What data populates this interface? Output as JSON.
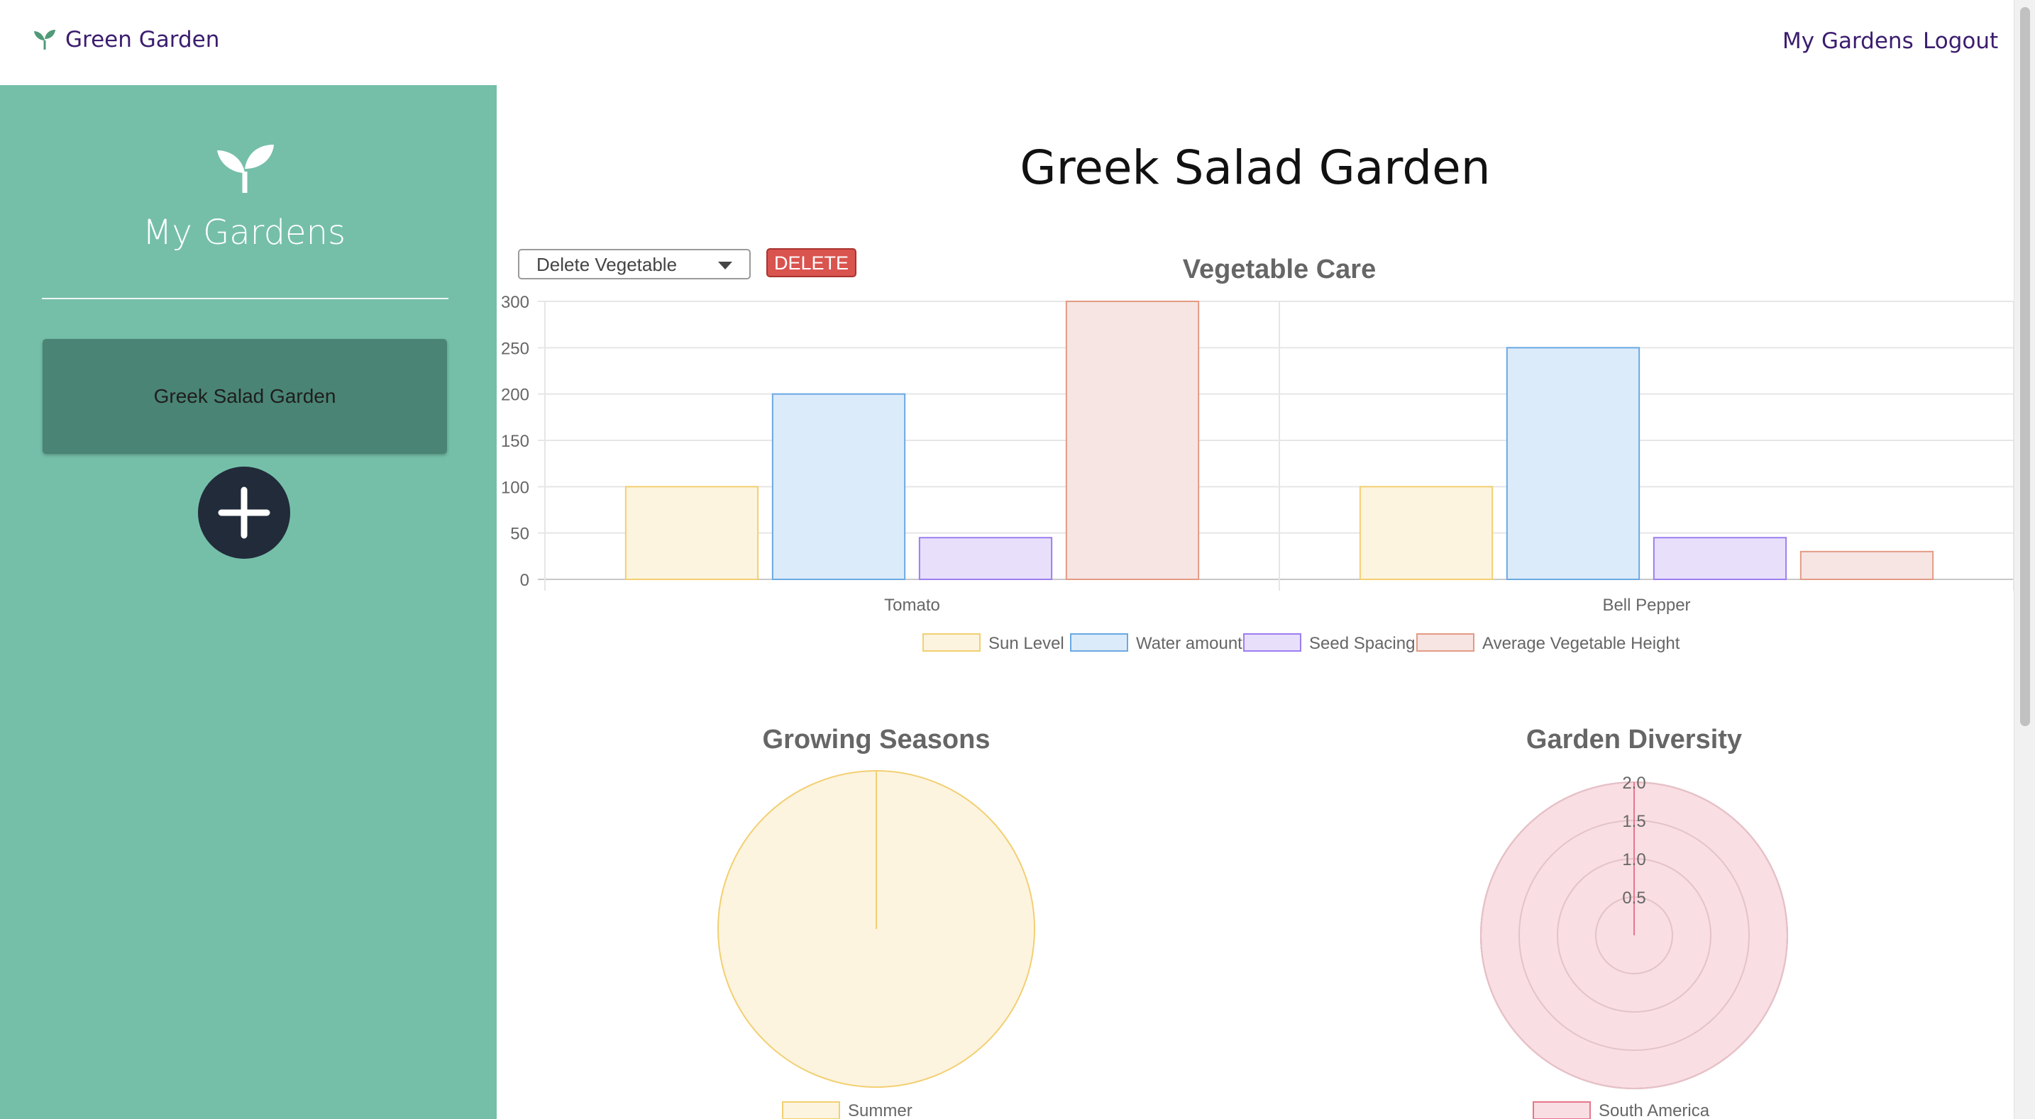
{
  "navbar": {
    "brand": "Green Garden",
    "links": [
      "My Gardens",
      "Logout"
    ]
  },
  "sidebar": {
    "title": "My Gardens",
    "gardens": [
      "Greek Salad Garden"
    ]
  },
  "page": {
    "title": "Greek Salad Garden"
  },
  "controls": {
    "select_value": "Delete Vegetable",
    "delete_label": "DELETE"
  },
  "colors": {
    "sidebar_bg": "#75bfa9",
    "card_bg": "#4a8474",
    "brand_text": "#3b1d6e",
    "delete_bg": "#d9534f"
  },
  "chart_data": [
    {
      "type": "bar",
      "title": "Vegetable Care",
      "categories": [
        "Tomato",
        "Bell Pepper"
      ],
      "series": [
        {
          "name": "Sun Level",
          "values": [
            100,
            100
          ],
          "fill": "#fdf4df",
          "stroke": "#f2cf72"
        },
        {
          "name": "Water amount",
          "values": [
            200,
            250
          ],
          "fill": "#dcebf9",
          "stroke": "#6aa9e4"
        },
        {
          "name": "Seed Spacing",
          "values": [
            45,
            45
          ],
          "fill": "#e8e0fb",
          "stroke": "#9c7ef0"
        },
        {
          "name": "Average Vegetable Height",
          "values": [
            300,
            30
          ],
          "fill": "#f6e5e3",
          "stroke": "#e39b84"
        }
      ],
      "y_ticks": [
        "0",
        "50",
        "100",
        "150",
        "200",
        "250",
        "300"
      ],
      "ylim": [
        0,
        300
      ],
      "legend": "bottom",
      "grid": true
    },
    {
      "type": "pie",
      "title": "Growing Seasons",
      "labels": [
        "Summer"
      ],
      "values": [
        1
      ],
      "fill": "#fdf4df",
      "stroke": "#f2cf72",
      "legend": "bottom"
    },
    {
      "type": "polar",
      "title": "Garden Diversity",
      "labels": [
        "South America"
      ],
      "values": [
        2
      ],
      "r_ticks": [
        "0.5",
        "1.0",
        "1.5",
        "2.0"
      ],
      "rlim": [
        0,
        2
      ],
      "fill": "#f9dee3",
      "stroke": "#e8768d",
      "legend": "bottom"
    }
  ]
}
